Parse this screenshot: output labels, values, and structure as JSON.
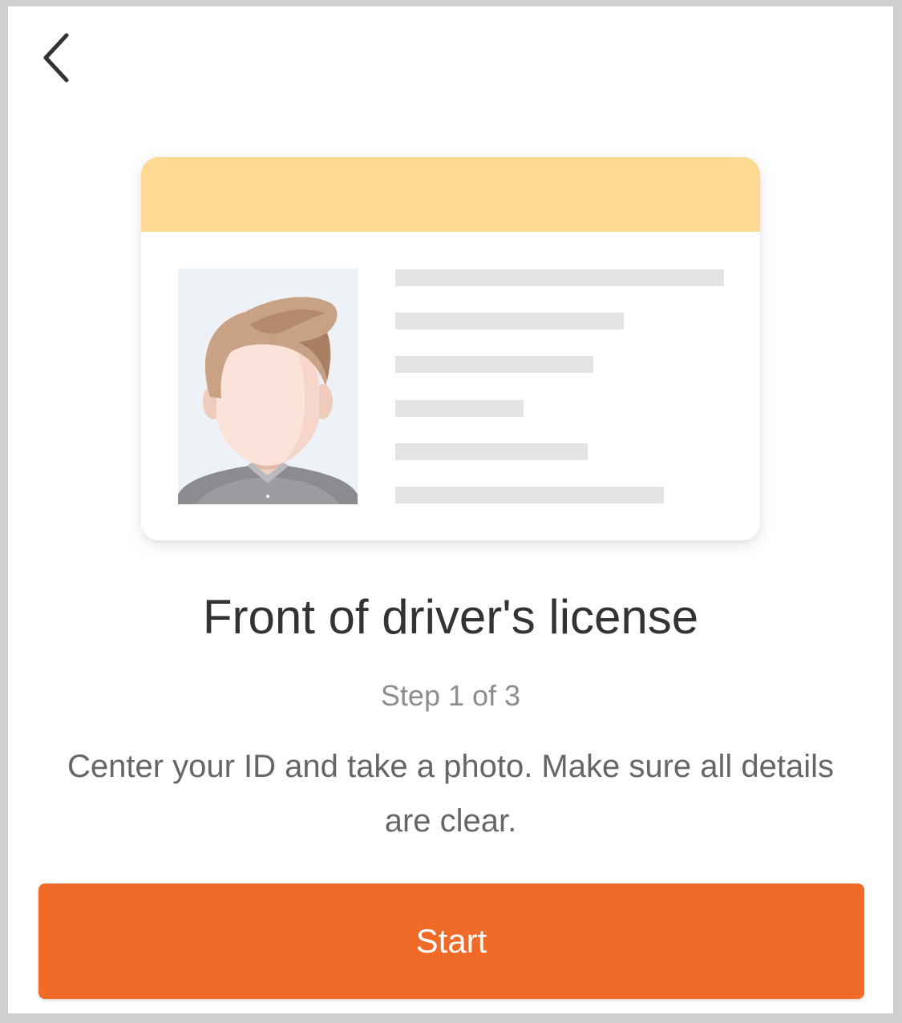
{
  "header": {
    "back_icon": "chevron-left-icon"
  },
  "illustration": {
    "kind": "id-card-illustration",
    "header_color": "#fdd993",
    "placeholder_line_color": "#e2e4e6",
    "photo_background": "#eef2f6",
    "portrait_icon": "person-portrait-icon"
  },
  "content": {
    "title": "Front of driver's license",
    "step": "Step 1 of 3",
    "description": "Center your ID and take a photo. Make sure all details are clear."
  },
  "actions": {
    "start_label": "Start",
    "start_color": "#f06a28"
  }
}
